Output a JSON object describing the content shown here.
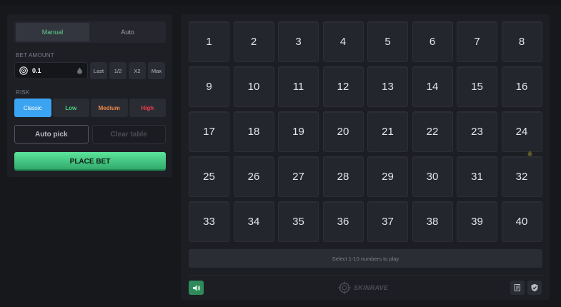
{
  "mode_tabs": {
    "manual": "Manual",
    "auto": "Auto",
    "active": "Manual"
  },
  "bet": {
    "label": "BET AMOUNT",
    "value": "0.1",
    "buttons": {
      "last": "Last",
      "half": "1/2",
      "double": "X2",
      "max": "Max"
    }
  },
  "risk": {
    "label": "RISK",
    "options": {
      "classic": "Classic",
      "low": "Low",
      "medium": "Medium",
      "high": "High"
    },
    "selected": "Classic"
  },
  "actions": {
    "auto_pick": "Auto pick",
    "clear_table": "Clear table",
    "place_bet": "PLACE BET"
  },
  "board": {
    "numbers": [
      "1",
      "2",
      "3",
      "4",
      "5",
      "6",
      "7",
      "8",
      "9",
      "10",
      "11",
      "12",
      "13",
      "14",
      "15",
      "16",
      "17",
      "18",
      "19",
      "20",
      "21",
      "22",
      "23",
      "24",
      "25",
      "26",
      "27",
      "28",
      "29",
      "30",
      "31",
      "32",
      "33",
      "34",
      "35",
      "36",
      "37",
      "38",
      "39",
      "40"
    ],
    "info": "Select 1-10 numbers to play"
  },
  "footer": {
    "brand": "SKINRAVE"
  },
  "icons": {
    "coin": "coin-icon",
    "drop": "droplet-icon",
    "sound": "speaker-icon",
    "brand": "crosshair-logo-icon",
    "fairness": "scroll-icon",
    "shield": "shield-check-icon"
  },
  "colors": {
    "accent_green": "#4cd37d",
    "classic_blue": "#3ba4f2",
    "medium_orange": "#ef8a4c",
    "high_red": "#ef3f4c",
    "place_bet_green": "#5ce49b"
  }
}
